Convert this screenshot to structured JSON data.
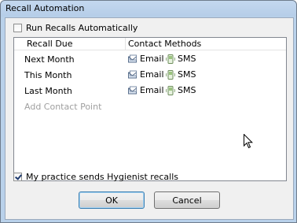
{
  "window": {
    "title": "Recall Automation"
  },
  "run_recalls": {
    "label": "Run Recalls Automatically",
    "checked": false
  },
  "grid": {
    "headers": {
      "recall_due": "Recall Due",
      "contact_methods": "Contact Methods"
    },
    "rows": [
      {
        "recall_due": "Next Month",
        "email": "Email",
        "sms": "SMS"
      },
      {
        "recall_due": "This Month",
        "email": "Email",
        "sms": "SMS"
      },
      {
        "recall_due": "Last Month",
        "email": "Email",
        "sms": "SMS"
      }
    ],
    "add_contact_point": "Add Contact Point"
  },
  "hygienist": {
    "label": "My practice sends Hygienist recalls",
    "checked": true
  },
  "buttons": {
    "ok": "OK",
    "cancel": "Cancel"
  },
  "icons": {
    "email": "envelope-icon",
    "sms": "mobile-phone-icon",
    "cursor": "mouse-pointer-icon"
  }
}
